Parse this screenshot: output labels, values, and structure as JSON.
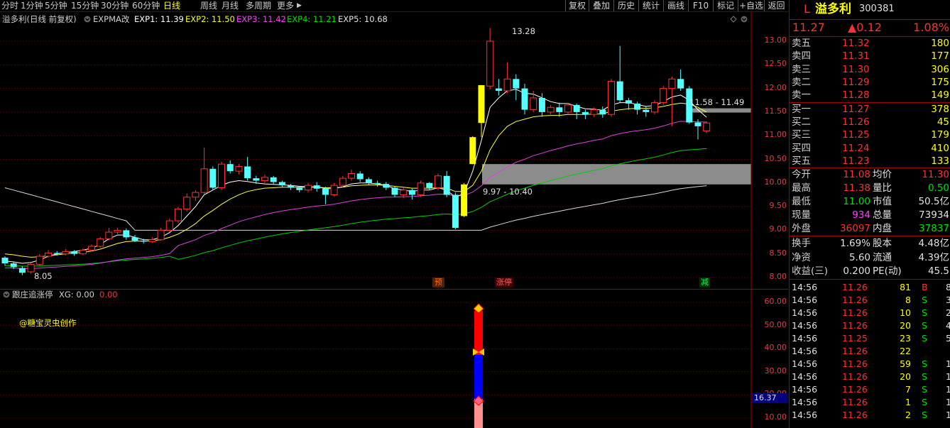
{
  "toolbar": {
    "periods": [
      "分时",
      "1分钟",
      "5分钟",
      "15分钟",
      "30分钟",
      "60分钟",
      "日线",
      "周线",
      "月线",
      "多周期",
      "更多"
    ],
    "active_period": "日线",
    "more_arrow": "▶",
    "buttons": [
      "复权",
      "叠加",
      "历史",
      "统计",
      "画线",
      "F10",
      "标记",
      "+自选",
      "返回"
    ]
  },
  "main_chart": {
    "title": "溢多利(日线 前复权)",
    "indicator": "EXPMA改",
    "exp": [
      {
        "label": "EXP1: 11.39",
        "color": "#ffffff"
      },
      {
        "label": "EXP2: 11.50",
        "color": "#ffff00"
      },
      {
        "label": "EXP3: 11.42",
        "color": "#ff40ff"
      },
      {
        "label": "EXP4: 11.21",
        "color": "#00e000"
      },
      {
        "label": "EXP5: 10.68",
        "color": "#e0e0e0"
      }
    ],
    "price_ticks": [
      "13.00",
      "12.50",
      "12.00",
      "11.50",
      "11.00",
      "10.50",
      "10.00",
      "9.50",
      "9.00",
      "8.50",
      "8.00"
    ],
    "high_label": "13.28",
    "low_label": "8.05",
    "zone_upper_label": "11.58 - 11.49",
    "zone_lower_label": "9.97 - 10.40",
    "markers": {
      "m1": "预",
      "m2": "涨停",
      "m3": "减"
    }
  },
  "chart_data": {
    "type": "candlestick",
    "ylim": [
      7.9,
      13.45
    ],
    "candles": [
      [
        8.42,
        8.3,
        8.45,
        8.25
      ],
      [
        8.3,
        8.22,
        8.34,
        8.18
      ],
      [
        8.2,
        8.1,
        8.24,
        8.05
      ],
      [
        8.12,
        8.28,
        8.32,
        8.08
      ],
      [
        8.28,
        8.45,
        8.5,
        8.25
      ],
      [
        8.45,
        8.52,
        8.58,
        8.42
      ],
      [
        8.52,
        8.5,
        8.56,
        8.46
      ],
      [
        8.5,
        8.55,
        8.6,
        8.47
      ],
      [
        8.55,
        8.5,
        8.58,
        8.46
      ],
      [
        8.5,
        8.58,
        8.62,
        8.48
      ],
      [
        8.58,
        8.66,
        8.7,
        8.55
      ],
      [
        8.66,
        8.82,
        8.86,
        8.63
      ],
      [
        8.82,
        8.96,
        9.05,
        8.78
      ],
      [
        8.96,
        9.0,
        9.05,
        8.92
      ],
      [
        9.0,
        8.85,
        9.04,
        8.8
      ],
      [
        8.85,
        8.78,
        8.9,
        8.75
      ],
      [
        8.78,
        8.76,
        8.82,
        8.72
      ],
      [
        8.76,
        8.8,
        8.85,
        8.73
      ],
      [
        8.8,
        9.0,
        9.05,
        8.78
      ],
      [
        9.0,
        9.2,
        9.25,
        8.97
      ],
      [
        9.2,
        9.45,
        9.5,
        9.15
      ],
      [
        9.45,
        9.7,
        9.78,
        9.4
      ],
      [
        9.7,
        9.8,
        9.85,
        9.62
      ],
      [
        9.8,
        10.3,
        10.75,
        9.75
      ],
      [
        10.3,
        9.9,
        10.35,
        9.85
      ],
      [
        9.9,
        10.4,
        10.45,
        9.85
      ],
      [
        10.4,
        10.25,
        10.48,
        10.2
      ],
      [
        10.25,
        10.35,
        10.4,
        10.18
      ],
      [
        10.35,
        10.1,
        10.55,
        10.05
      ],
      [
        10.1,
        10.05,
        10.15,
        9.98
      ],
      [
        10.05,
        10.12,
        10.18,
        10.0
      ],
      [
        10.12,
        10.02,
        10.15,
        9.98
      ],
      [
        10.02,
        9.95,
        10.05,
        9.9
      ],
      [
        9.95,
        9.9,
        9.98,
        9.85
      ],
      [
        9.9,
        9.85,
        9.92,
        9.8
      ],
      [
        9.85,
        9.95,
        10.0,
        9.8
      ],
      [
        9.95,
        9.88,
        10.02,
        9.82
      ],
      [
        9.88,
        9.75,
        9.92,
        9.55
      ],
      [
        9.75,
        9.95,
        10.0,
        9.72
      ],
      [
        9.95,
        10.1,
        10.15,
        9.9
      ],
      [
        10.1,
        10.2,
        10.28,
        10.05
      ],
      [
        10.2,
        10.08,
        10.25,
        10.02
      ],
      [
        10.08,
        10.0,
        10.12,
        9.95
      ],
      [
        10.0,
        9.98,
        10.05,
        9.92
      ],
      [
        9.98,
        9.9,
        10.02,
        9.85
      ],
      [
        9.9,
        9.75,
        9.92,
        9.7
      ],
      [
        9.75,
        9.85,
        9.9,
        9.68
      ],
      [
        9.85,
        9.75,
        9.88,
        9.65
      ],
      [
        9.75,
        10.0,
        10.05,
        9.7
      ],
      [
        10.0,
        9.9,
        10.02,
        9.85
      ],
      [
        9.9,
        10.15,
        10.2,
        9.85
      ],
      [
        10.15,
        9.75,
        10.25,
        9.7
      ],
      [
        9.75,
        9.05,
        9.8,
        9.02
      ],
      [
        9.3,
        9.97,
        10.0,
        9.28
      ],
      [
        10.4,
        10.97,
        10.99,
        10.4
      ],
      [
        11.27,
        12.07,
        12.07,
        10.97
      ],
      [
        12.05,
        13.0,
        13.28,
        11.98
      ],
      [
        12.0,
        11.95,
        12.2,
        11.85
      ],
      [
        11.95,
        12.2,
        12.55,
        11.9
      ],
      [
        12.2,
        12.0,
        12.3,
        11.75
      ],
      [
        12.0,
        11.55,
        12.1,
        11.45
      ],
      [
        11.55,
        11.8,
        11.95,
        11.5
      ],
      [
        11.8,
        11.5,
        11.9,
        11.4
      ],
      [
        11.5,
        11.6,
        11.65,
        11.45
      ],
      [
        11.6,
        11.5,
        11.7,
        11.4
      ],
      [
        11.5,
        11.65,
        11.7,
        11.45
      ],
      [
        11.65,
        11.5,
        11.68,
        11.35
      ],
      [
        11.5,
        11.45,
        11.55,
        11.35
      ],
      [
        11.45,
        11.55,
        11.6,
        11.4
      ],
      [
        11.55,
        11.45,
        11.62,
        11.38
      ],
      [
        11.45,
        12.15,
        12.2,
        11.4
      ],
      [
        12.15,
        11.75,
        12.9,
        11.7
      ],
      [
        11.75,
        11.68,
        11.8,
        11.55
      ],
      [
        11.68,
        11.55,
        11.72,
        11.45
      ],
      [
        11.55,
        11.5,
        11.62,
        11.4
      ],
      [
        11.5,
        11.7,
        11.75,
        11.45
      ],
      [
        11.7,
        12.0,
        12.05,
        11.65
      ],
      [
        12.0,
        12.2,
        12.25,
        11.2
      ],
      [
        12.2,
        12.0,
        12.4,
        11.95
      ],
      [
        12.0,
        11.28,
        12.05,
        11.25
      ],
      [
        11.28,
        11.2,
        11.35,
        10.92
      ],
      [
        11.1,
        11.27,
        11.3,
        11.05
      ]
    ],
    "exp_lines": {
      "exp1": [
        8.35,
        8.33,
        8.3,
        8.32,
        8.37,
        8.45,
        8.5,
        8.53,
        8.55,
        8.58,
        8.62,
        8.7,
        8.82,
        8.9,
        8.9,
        8.85,
        8.8,
        8.8,
        8.85,
        8.95,
        9.1,
        9.3,
        9.5,
        9.75,
        9.85,
        9.95,
        10.02,
        10.05,
        10.03,
        10.0,
        9.98,
        9.97,
        9.96,
        9.95,
        9.93,
        9.92,
        9.92,
        9.88,
        9.88,
        9.92,
        9.98,
        10.0,
        10.0,
        9.98,
        9.95,
        9.88,
        9.85,
        9.82,
        9.85,
        9.85,
        9.9,
        9.85,
        9.7,
        9.78,
        10.25,
        10.9,
        11.6,
        11.8,
        11.95,
        11.98,
        11.9,
        11.88,
        11.8,
        11.72,
        11.68,
        11.68,
        11.62,
        11.57,
        11.56,
        11.54,
        11.65,
        11.7,
        11.7,
        11.66,
        11.62,
        11.64,
        11.72,
        11.82,
        11.86,
        11.75,
        11.55,
        11.39
      ],
      "exp2": [
        8.5,
        8.48,
        8.45,
        8.43,
        8.44,
        8.46,
        8.48,
        8.5,
        8.52,
        8.53,
        8.56,
        8.6,
        8.66,
        8.72,
        8.76,
        8.77,
        8.77,
        8.78,
        8.8,
        8.85,
        8.92,
        9.02,
        9.14,
        9.3,
        9.42,
        9.55,
        9.66,
        9.75,
        9.82,
        9.86,
        9.89,
        9.9,
        9.91,
        9.91,
        9.91,
        9.91,
        9.91,
        9.9,
        9.9,
        9.91,
        9.94,
        9.95,
        9.96,
        9.96,
        9.95,
        9.93,
        9.91,
        9.89,
        9.89,
        9.89,
        9.9,
        9.89,
        9.82,
        9.82,
        9.95,
        10.25,
        10.7,
        11.0,
        11.2,
        11.3,
        11.35,
        11.4,
        11.42,
        11.43,
        11.43,
        11.45,
        11.45,
        11.45,
        11.46,
        11.46,
        11.52,
        11.55,
        11.57,
        11.58,
        11.58,
        11.59,
        11.62,
        11.66,
        11.69,
        11.67,
        11.6,
        11.5
      ]
    },
    "zones": [
      {
        "label": "11.58 - 11.49",
        "low": 11.49,
        "high": 11.58
      },
      {
        "label": "9.97 - 10.40",
        "low": 9.97,
        "high": 10.4
      }
    ]
  },
  "sub_chart": {
    "title": "跟庄追涨停",
    "xg_label": "XG: 0.00",
    "value_label": "0.00",
    "credit": "@糖宝灵虫创作",
    "ticks": [
      "60.00",
      "50.00",
      "40.00",
      "30.00",
      "20.00",
      "10.00"
    ],
    "current_tag": "16.37"
  },
  "quote": {
    "prefix": "L",
    "name": "溢多利",
    "code": "300381",
    "price": "11.27",
    "change": "▲0.12",
    "change_pct": "1.08%",
    "asks": [
      {
        "label": "卖五",
        "price": "11.32",
        "vol": "180"
      },
      {
        "label": "卖四",
        "price": "11.31",
        "vol": "177"
      },
      {
        "label": "卖三",
        "price": "11.30",
        "vol": "306"
      },
      {
        "label": "卖二",
        "price": "11.29",
        "vol": "175"
      },
      {
        "label": "卖一",
        "price": "11.28",
        "vol": "149"
      }
    ],
    "bids": [
      {
        "label": "买一",
        "price": "11.27",
        "vol": "378"
      },
      {
        "label": "买二",
        "price": "11.26",
        "vol": "45"
      },
      {
        "label": "买三",
        "price": "11.25",
        "vol": "179"
      },
      {
        "label": "买四",
        "price": "11.24",
        "vol": "410"
      },
      {
        "label": "买五",
        "price": "11.23",
        "vol": "133"
      }
    ],
    "stats": [
      {
        "l1": "今开",
        "v1": "11.08",
        "l2": "均价",
        "v2": "11.30"
      },
      {
        "l1": "最高",
        "v1": "11.38",
        "l2": "量比",
        "v2": "0.50"
      },
      {
        "l1": "最低",
        "v1": "11.00",
        "l2": "市值",
        "v2": "50.5亿"
      },
      {
        "l1": "现量",
        "v1": "934",
        "l2": "总量",
        "v2": "73934"
      },
      {
        "l1": "外盘",
        "v1": "36097",
        "l2": "内盘",
        "v2": "37837"
      }
    ],
    "fund": [
      {
        "l1": "换手",
        "v1": "1.69%",
        "l2": "股本",
        "v2": "4.48亿"
      },
      {
        "l1": "净资",
        "v1": "5.60",
        "l2": "流通",
        "v2": "4.39亿"
      },
      {
        "l1": "收益(三)",
        "v1": "0.200",
        "l2": "PE(动)",
        "v2": "45.5"
      }
    ],
    "ticks": [
      {
        "t": "14:56",
        "p": "11.26",
        "v": "81",
        "s": "B",
        "n": "8"
      },
      {
        "t": "14:56",
        "p": "11.26",
        "v": "8",
        "s": "S",
        "n": "3"
      },
      {
        "t": "14:56",
        "p": "11.26",
        "v": "10",
        "s": "S",
        "n": "2"
      },
      {
        "t": "14:56",
        "p": "11.26",
        "v": "20",
        "s": "S",
        "n": "4"
      },
      {
        "t": "14:56",
        "p": "11.25",
        "v": "23",
        "s": "S",
        "n": "5"
      },
      {
        "t": "14:56",
        "p": "11.26",
        "v": "22",
        "s": "",
        "n": ""
      },
      {
        "t": "14:56",
        "p": "11.26",
        "v": "59",
        "s": "S",
        "n": "1"
      },
      {
        "t": "14:56",
        "p": "11.26",
        "v": "20",
        "s": "S",
        "n": "1"
      },
      {
        "t": "14:56",
        "p": "11.26",
        "v": "7",
        "s": "S",
        "n": "1"
      },
      {
        "t": "14:56",
        "p": "11.26",
        "v": "1",
        "s": "S",
        "n": "1"
      },
      {
        "t": "14:56",
        "p": "11.26",
        "v": "2",
        "s": "S",
        "n": "1"
      }
    ]
  }
}
